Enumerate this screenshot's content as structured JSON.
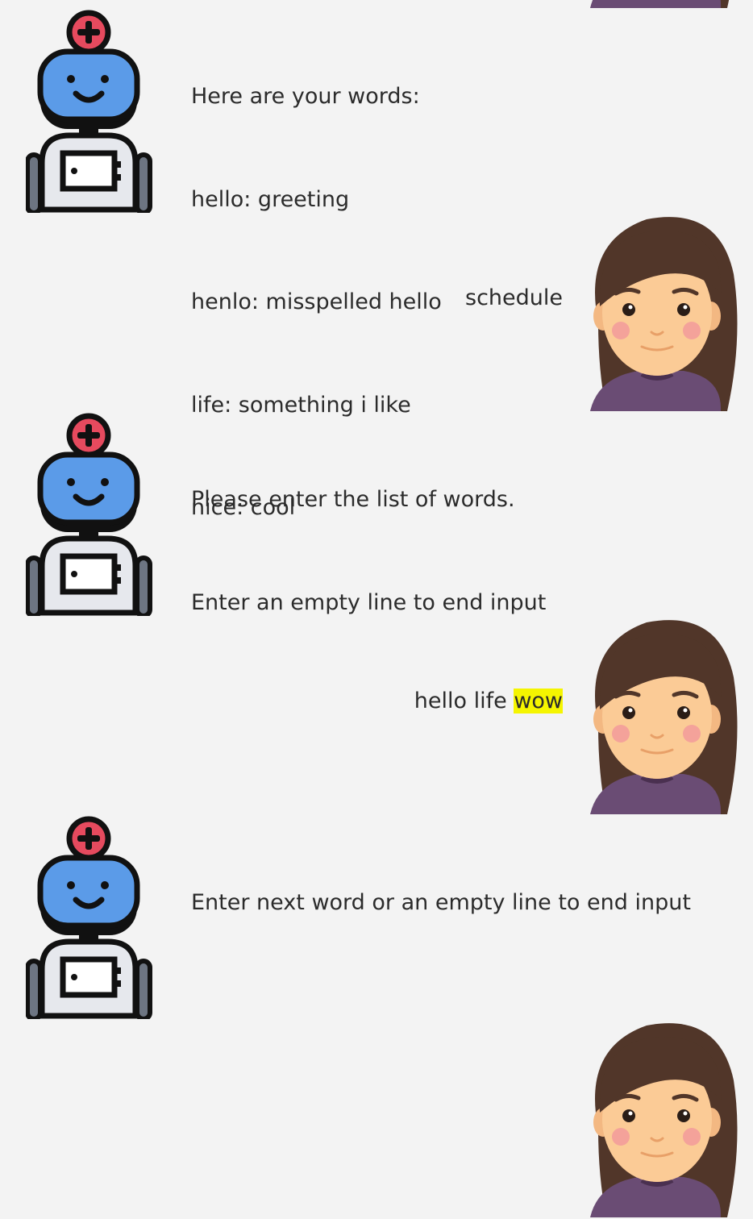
{
  "chat": {
    "messages": [
      {
        "sender": "bot",
        "avatar_icon": "robot-icon",
        "lines": [
          "Here are your words:",
          "hello: greeting",
          "henlo: misspelled hello",
          "life: something i like",
          "nice: cool"
        ]
      },
      {
        "sender": "user",
        "avatar_icon": "woman-icon",
        "lines": [
          "schedule"
        ]
      },
      {
        "sender": "bot",
        "avatar_icon": "robot-icon",
        "lines": [
          "Please enter the list of words.",
          "Enter an empty line to end input"
        ]
      },
      {
        "sender": "user",
        "avatar_icon": "woman-icon",
        "text_plain": "hello life ",
        "text_highlighted": "wow",
        "highlight_color": "#f5f500"
      },
      {
        "sender": "bot",
        "avatar_icon": "robot-icon",
        "lines": [
          "Enter next word or an empty line to end input"
        ]
      }
    ]
  },
  "colors": {
    "background": "#f3f3f3",
    "robot_head": "#5b9be8",
    "robot_antenna": "#e64a5e",
    "robot_body": "#e6e8ed",
    "hair": "#513629",
    "skin": "#fbcb96",
    "shirt": "#6a4c74"
  }
}
